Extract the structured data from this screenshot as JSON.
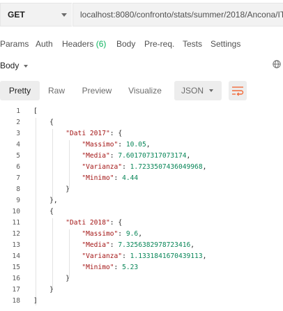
{
  "request": {
    "method": "GET",
    "url": "localhost:8080/confronto/stats/summer/2018/Ancona/IT"
  },
  "request_tabs": [
    {
      "label": "Params"
    },
    {
      "label": "Auth"
    },
    {
      "label": "Headers",
      "badge": "(6)"
    },
    {
      "label": "Body"
    },
    {
      "label": "Pre-req."
    },
    {
      "label": "Tests"
    },
    {
      "label": "Settings"
    }
  ],
  "response": {
    "section_label": "Body",
    "view_tabs": [
      "Pretty",
      "Raw",
      "Preview",
      "Visualize"
    ],
    "active_view": "Pretty",
    "format": "JSON",
    "icons": [
      "globe-icon",
      "wrap-lines-icon",
      "chevron-down-icon"
    ]
  },
  "code_lines": [
    {
      "n": "1",
      "t": "["
    },
    {
      "n": "2",
      "t": "    {"
    },
    {
      "n": "3",
      "t": "        \"Dati 2017\": {"
    },
    {
      "n": "4",
      "t": "            \"Massimo\": 10.05,"
    },
    {
      "n": "5",
      "t": "            \"Media\": 7.601707317073174,"
    },
    {
      "n": "6",
      "t": "            \"Varianza\": 1.7233507436049968,"
    },
    {
      "n": "7",
      "t": "            \"Minimo\": 4.44"
    },
    {
      "n": "8",
      "t": "        }"
    },
    {
      "n": "9",
      "t": "    },"
    },
    {
      "n": "10",
      "t": "    {"
    },
    {
      "n": "11",
      "t": "        \"Dati 2018\": {"
    },
    {
      "n": "12",
      "t": "            \"Massimo\": 9.6,"
    },
    {
      "n": "13",
      "t": "            \"Media\": 7.3256382978723416,"
    },
    {
      "n": "14",
      "t": "            \"Varianza\": 1.1331841670439113,"
    },
    {
      "n": "15",
      "t": "            \"Minimo\": 5.23"
    },
    {
      "n": "16",
      "t": "        }"
    },
    {
      "n": "17",
      "t": "    }"
    },
    {
      "n": "18",
      "t": "]"
    }
  ],
  "colors": {
    "json_key": "#a31515",
    "json_number": "#098658",
    "badge": "#0cb35e",
    "wrap_icon": "#f26b3a"
  }
}
